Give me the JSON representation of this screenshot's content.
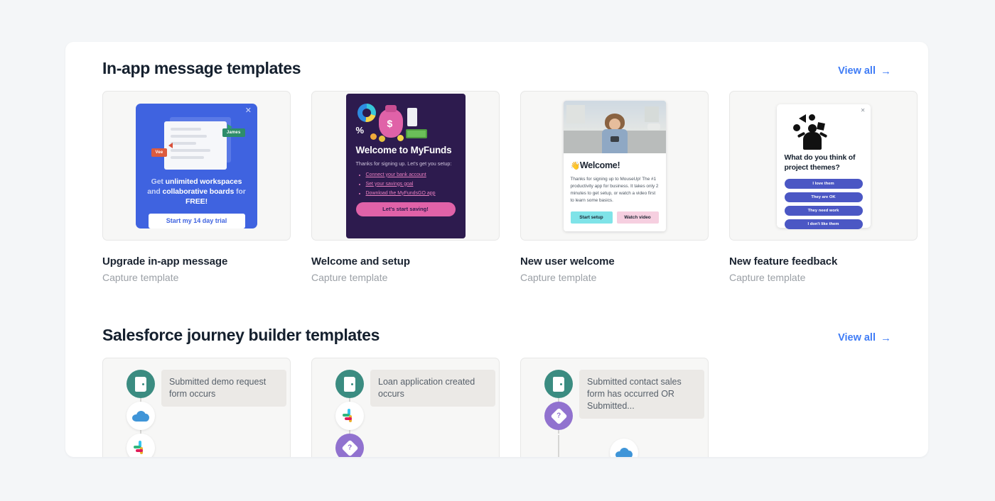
{
  "sections": [
    {
      "title": "In-app message templates",
      "view_all_label": "View all",
      "view_all_arrow": "→",
      "cards": [
        {
          "title": "Upgrade in-app message",
          "subtitle": "Capture template"
        },
        {
          "title": "Welcome and setup",
          "subtitle": "Capture template"
        },
        {
          "title": "New user welcome",
          "subtitle": "Capture template"
        },
        {
          "title": "New feature feedback",
          "subtitle": "Capture template"
        }
      ]
    },
    {
      "title": "Salesforce journey builder templates",
      "view_all_label": "View all",
      "view_all_arrow": "→",
      "journeys": [
        {
          "trigger": "Submitted demo request form occurs"
        },
        {
          "trigger": "Loan application created occurs"
        },
        {
          "trigger": "Submitted contact sales form has occurred OR Submitted..."
        }
      ]
    }
  ],
  "preview_upgrade": {
    "close": "✕",
    "tag_james": "James",
    "tag_vee": "Vee",
    "headline_pre": "Get ",
    "headline_bold1": "unlimited workspaces",
    "headline_mid": " and ",
    "headline_bold2": "collaborative boards",
    "headline_post": " for ",
    "headline_bold3": "FREE!",
    "cta": "Start my 14 day trial"
  },
  "preview_myfunds": {
    "percent_symbol": "%",
    "dollar_symbol": "$",
    "title": "Welcome to MyFunds",
    "subtitle": "Thanks for signing up. Let's get you setup:",
    "links": [
      "Connect your bank account",
      "Set your savings goal",
      "Download the MyFundsGO app"
    ],
    "cta": "Let's start saving!"
  },
  "preview_newuser": {
    "wave_emoji": "👋",
    "heading": "Welcome!",
    "body": "Thanks for signing up to MouseUp! The #1 productivity app for business. It takes only 2 minutes to get setup, or watch a video first to learn some basics.",
    "btn_primary": "Start setup",
    "btn_secondary": "Watch video"
  },
  "preview_feedback": {
    "close": "✕",
    "question": "What do you think of project themes?",
    "options": [
      "I love them",
      "They are OK",
      "They need work",
      "I don't like them"
    ]
  },
  "icons": {
    "decision": "?"
  },
  "colors": {
    "page_background": "#f4f6f8",
    "panel": "#ffffff",
    "title": "#15202e",
    "link_blue": "#3f7cf6",
    "muted": "#9ba0a6",
    "upgrade_blue": "#3f63e0",
    "myfunds_purple": "#2d1b4e",
    "myfunds_pink": "#e062a8",
    "feedback_indigo": "#4b57c4",
    "journey_teal": "#3b8c81",
    "journey_purple": "#9172cf",
    "setup_cyan": "#7fe3e8",
    "video_pink": "#f6cfe0"
  }
}
